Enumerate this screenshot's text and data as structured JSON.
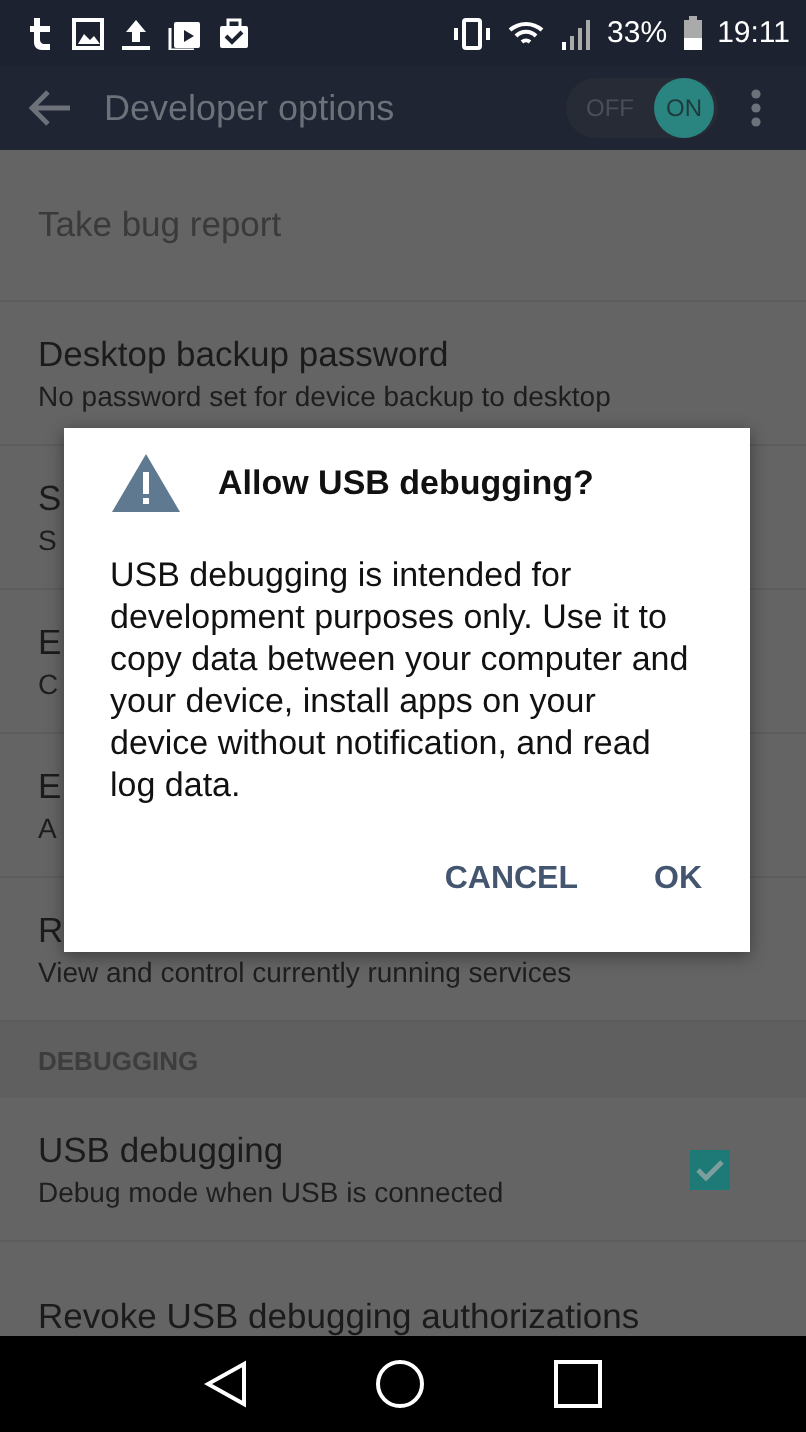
{
  "status_bar": {
    "battery": "33%",
    "time": "19:11"
  },
  "toolbar": {
    "title": "Developer options",
    "toggle": {
      "off_label": "OFF",
      "on_label": "ON",
      "on": true
    }
  },
  "settings": [
    {
      "kind": "item",
      "title": "Take bug report",
      "disabled": true
    },
    {
      "kind": "item",
      "title": "Desktop backup password",
      "summary": "No password set for device backup to desktop",
      "disabled": false
    },
    {
      "kind": "item",
      "title": "S",
      "summary": "S",
      "disabled": false
    },
    {
      "kind": "item",
      "title": "E",
      "summary": "C",
      "disabled": false
    },
    {
      "kind": "item",
      "title": "E",
      "summary": "A",
      "disabled": false
    },
    {
      "kind": "item",
      "title": "R",
      "summary": "View and control currently running services",
      "disabled": false
    },
    {
      "kind": "header",
      "title": "DEBUGGING"
    },
    {
      "kind": "checkbox",
      "title": "USB debugging",
      "summary": "Debug mode when USB is connected",
      "checked": true
    },
    {
      "kind": "item",
      "title": "Revoke USB debugging authorizations",
      "disabled": false
    }
  ],
  "dialog": {
    "title": "Allow USB debugging?",
    "message": "USB debugging is intended for development purposes only. Use it to copy data between your computer and your device, install apps on your device without notification, and read log data.",
    "buttons": [
      "CANCEL",
      "OK"
    ]
  }
}
